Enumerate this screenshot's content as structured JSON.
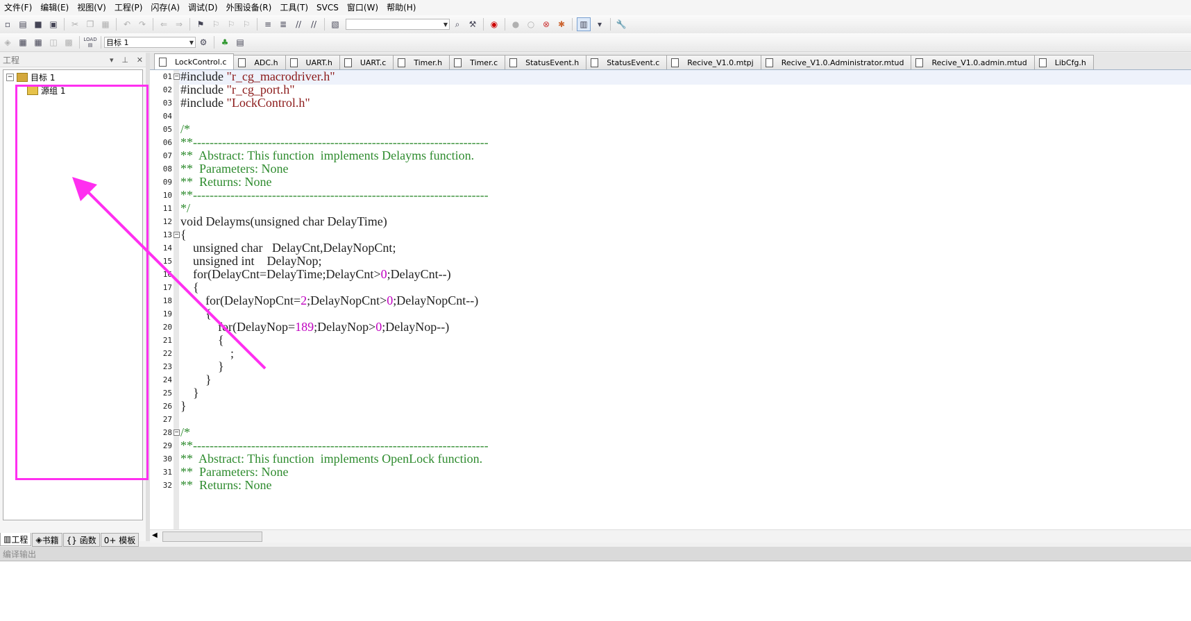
{
  "menu": [
    "文件(F)",
    "编辑(E)",
    "视图(V)",
    "工程(P)",
    "闪存(A)",
    "调试(D)",
    "外围设备(R)",
    "工具(T)",
    "SVCS",
    "窗口(W)",
    "帮助(H)"
  ],
  "toolbar2": {
    "load_label": "LOAD",
    "target_select": "目标 1"
  },
  "project_pane": {
    "title": "工程",
    "tree": {
      "root": "目标 1",
      "child": "源组 1"
    },
    "tabs": [
      "工程",
      "书籍",
      "{} 函数",
      "0+ 模板"
    ]
  },
  "file_tabs": [
    "LockControl.c",
    "ADC.h",
    "UART.h",
    "UART.c",
    "Timer.h",
    "Timer.c",
    "StatusEvent.h",
    "StatusEvent.c",
    "Recive_V1.0.mtpj",
    "Recive_V1.0.Administrator.mtud",
    "Recive_V1.0.admin.mtud",
    "LibCfg.h"
  ],
  "active_tab": "LockControl.c",
  "code_lines": [
    {
      "n": "01",
      "t": "#include \"r_cg_macrodriver.h\""
    },
    {
      "n": "02",
      "t": "#include \"r_cg_port.h\""
    },
    {
      "n": "03",
      "t": "#include \"LockControl.h\""
    },
    {
      "n": "04",
      "t": ""
    },
    {
      "n": "05",
      "t": "/*"
    },
    {
      "n": "06",
      "t": "**-----------------------------------------------------------------------"
    },
    {
      "n": "07",
      "t": "**  Abstract: This function  implements Delayms function."
    },
    {
      "n": "08",
      "t": "**  Parameters: None"
    },
    {
      "n": "09",
      "t": "**  Returns: None"
    },
    {
      "n": "10",
      "t": "**-----------------------------------------------------------------------"
    },
    {
      "n": "11",
      "t": "*/"
    },
    {
      "n": "12",
      "t": "void Delayms(unsigned char DelayTime)"
    },
    {
      "n": "13",
      "t": "{"
    },
    {
      "n": "14",
      "t": "    unsigned char   DelayCnt,DelayNopCnt;"
    },
    {
      "n": "15",
      "t": "    unsigned int    DelayNop;"
    },
    {
      "n": "16",
      "t": "    for(DelayCnt=DelayTime;DelayCnt>0;DelayCnt--)"
    },
    {
      "n": "17",
      "t": "    {"
    },
    {
      "n": "18",
      "t": "        for(DelayNopCnt=2;DelayNopCnt>0;DelayNopCnt--)"
    },
    {
      "n": "19",
      "t": "        {"
    },
    {
      "n": "20",
      "t": "            for(DelayNop=189;DelayNop>0;DelayNop--)"
    },
    {
      "n": "21",
      "t": "            {"
    },
    {
      "n": "22",
      "t": "                ;"
    },
    {
      "n": "23",
      "t": "            }"
    },
    {
      "n": "24",
      "t": "        }"
    },
    {
      "n": "25",
      "t": "    }"
    },
    {
      "n": "26",
      "t": "}"
    },
    {
      "n": "27",
      "t": ""
    },
    {
      "n": "28",
      "t": "/*"
    },
    {
      "n": "29",
      "t": "**-----------------------------------------------------------------------"
    },
    {
      "n": "30",
      "t": "**  Abstract: This function  implements OpenLock function."
    },
    {
      "n": "31",
      "t": "**  Parameters: None"
    },
    {
      "n": "32",
      "t": "**  Returns: None"
    }
  ],
  "output_pane": {
    "title": "编译输出"
  },
  "colors": {
    "annotation": "#ff2ff0",
    "string": "#8b1a1a",
    "comment": "#2e8b2e",
    "number": "#c000c0"
  }
}
